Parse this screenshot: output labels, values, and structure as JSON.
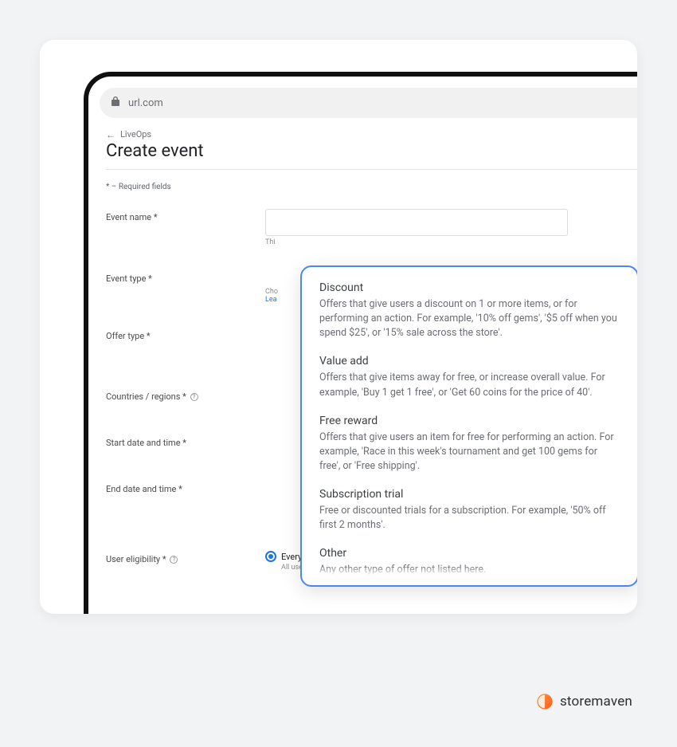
{
  "browser": {
    "url": "url.com",
    "lock_icon": "lock"
  },
  "breadcrumb": {
    "back_icon": "←",
    "parent": "LiveOps"
  },
  "page": {
    "title": "Create event",
    "required_note": "* – Required fields"
  },
  "form": {
    "event_name": {
      "label": "Event name *",
      "hint_prefix": "Thi"
    },
    "event_type": {
      "label": "Event type *",
      "hint_cho": "Cho",
      "hint_lea": "Lea"
    },
    "offer_type": {
      "label": "Offer type *"
    },
    "countries": {
      "label": "Countries / regions *",
      "help": "?"
    },
    "start": {
      "label": "Start date and time *"
    },
    "end": {
      "label": "End date and time *"
    },
    "user_elig": {
      "label": "User eligibility *",
      "help": "?",
      "option": "Everyone",
      "option_sub": "All users in your selected countries and regions"
    }
  },
  "offer_dropdown": [
    {
      "title": "Discount",
      "desc": "Offers that give users a discount on 1 or more items, or for performing an action. For example, '10% off gems', '$5 off when you spend $25', or '15% sale across the store'."
    },
    {
      "title": "Value add",
      "desc": "Offers that give items away for free, or increase overall value. For example, 'Buy 1 get 1 free', or 'Get 60 coins for the price of 40'."
    },
    {
      "title": "Free reward",
      "desc": "Offers that give users an item for free for performing an action. For example, 'Race in this week's tournament and get 100 gems for free', or 'Free shipping'."
    },
    {
      "title": "Subscription trial",
      "desc": "Free or discounted trials for a subscription. For example, '50% off first 2 months'."
    },
    {
      "title": "Other",
      "desc": "Any other type of offer not listed here."
    }
  ],
  "brand": {
    "name": "storemaven"
  }
}
